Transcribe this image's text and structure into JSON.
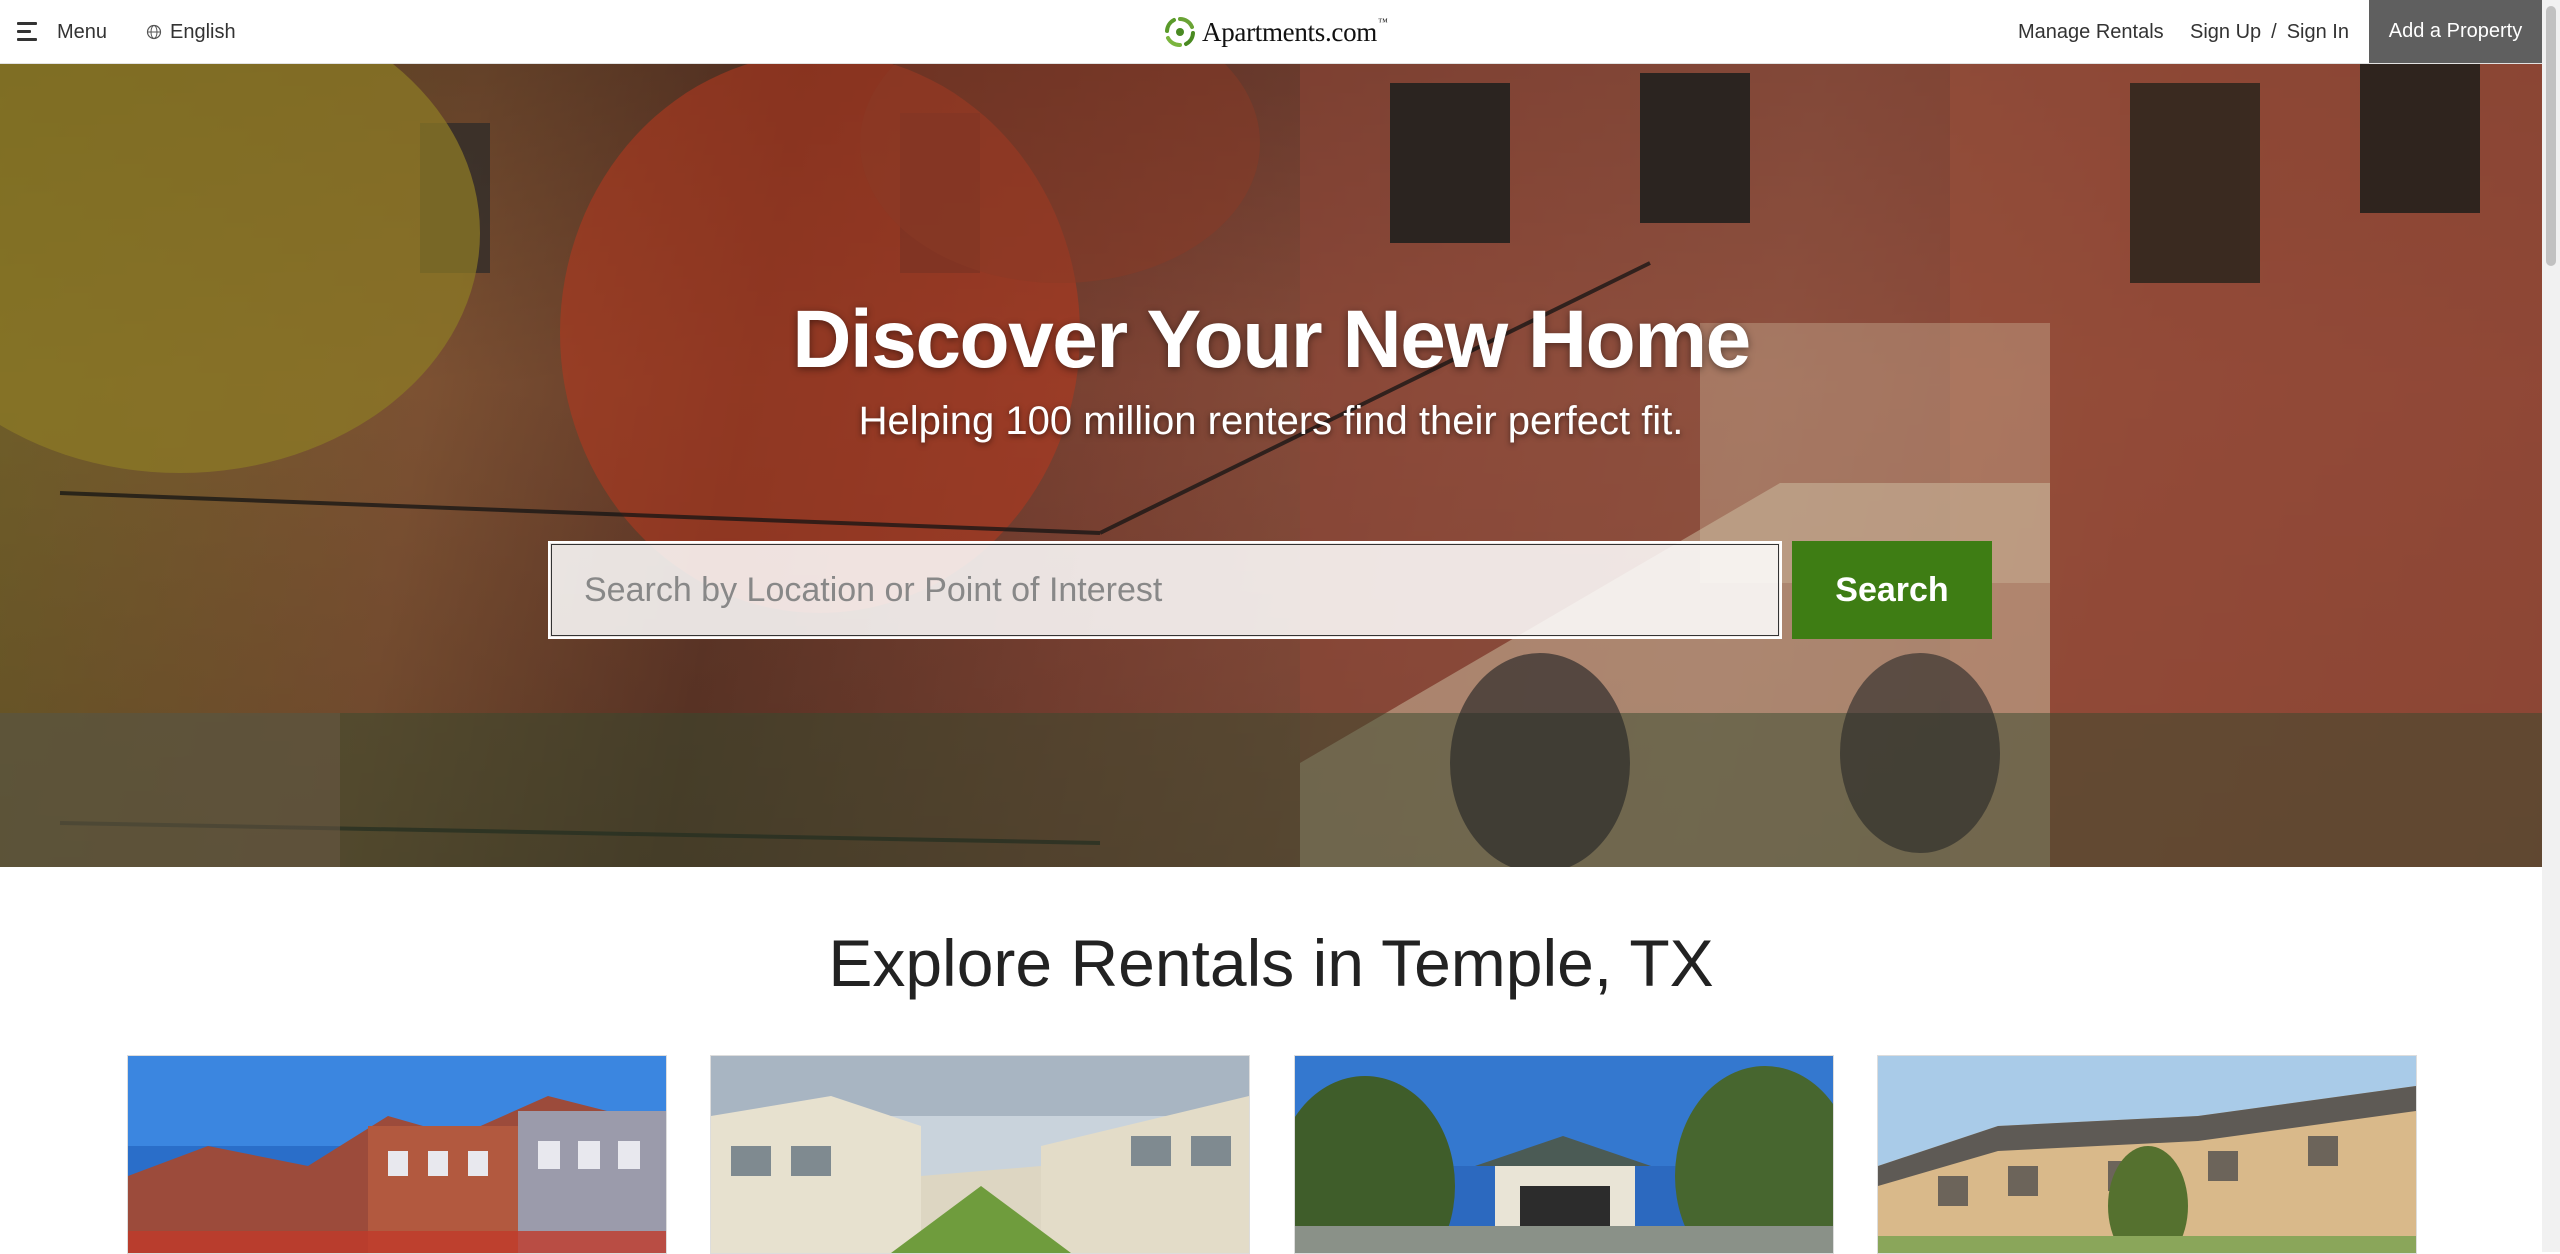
{
  "header": {
    "menu_label": "Menu",
    "language_label": "English",
    "logo_text": "Apartments.com",
    "logo_tm": "™",
    "manage_rentals": "Manage Rentals",
    "sign_up": "Sign Up",
    "separator": "/",
    "sign_in": "Sign In",
    "add_property": "Add a Property"
  },
  "hero": {
    "title": "Discover Your New Home",
    "subtitle": "Helping 100 million renters find their perfect fit.",
    "search_placeholder": "Search by Location or Point of Interest",
    "search_value": "",
    "search_button": "Search"
  },
  "explore": {
    "title": "Explore Rentals in Temple, TX",
    "cards": [
      {
        "name": "listing-photo-1"
      },
      {
        "name": "listing-photo-2"
      },
      {
        "name": "listing-photo-3"
      },
      {
        "name": "listing-photo-4"
      }
    ]
  },
  "colors": {
    "brand_green": "#3e7d14",
    "add_property_bg": "#5f5f5f"
  },
  "icons": [
    "hamburger-menu-icon",
    "globe-icon",
    "apartments-logo-icon"
  ]
}
